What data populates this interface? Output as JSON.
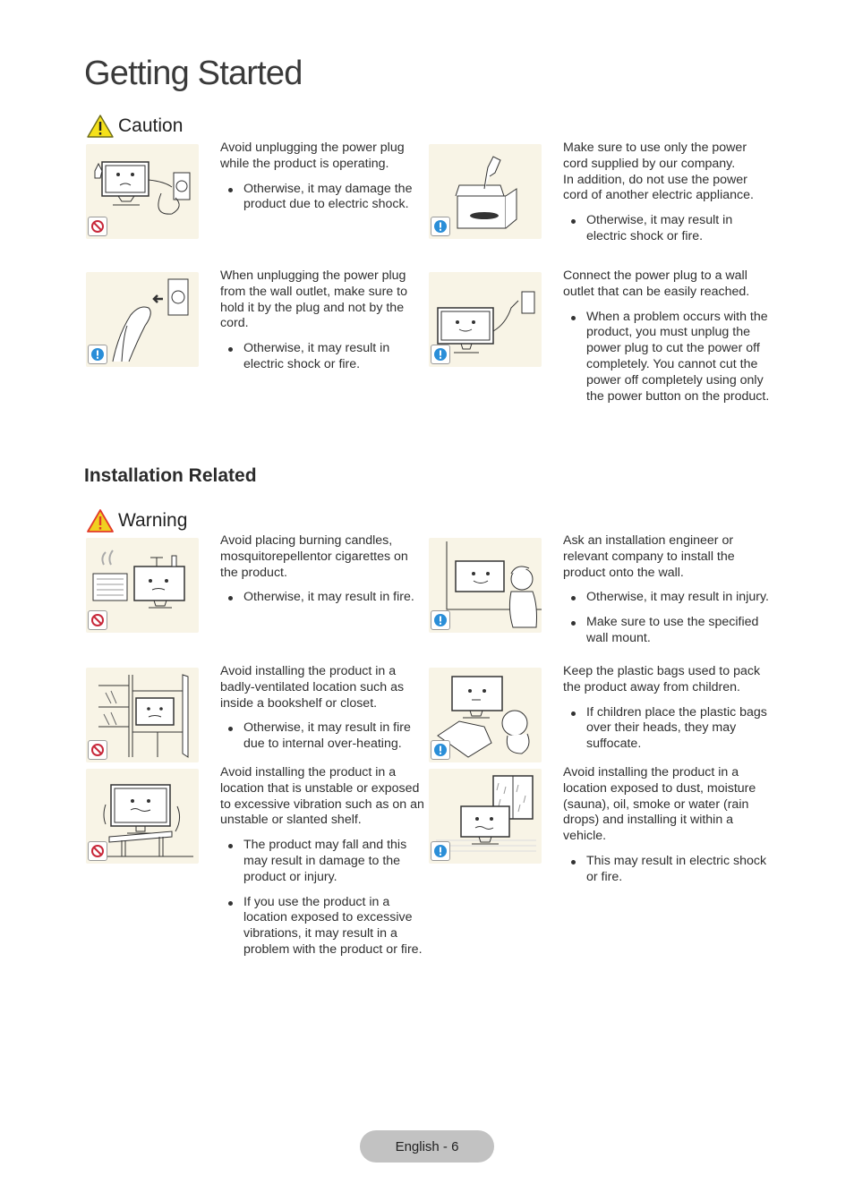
{
  "page": {
    "title": "Getting Started",
    "footer": "English - 6"
  },
  "caution": {
    "heading": "Caution",
    "heading_icon": "caution-triangle-icon",
    "icon_color": "#f5e11a",
    "items": [
      {
        "badge": "prohibited",
        "illustration": "tv-unplugging-while-operating",
        "text": "Avoid unplugging the power plug while the product is operating.",
        "bullets": [
          "Otherwise, it may damage the product due to electric shock."
        ]
      },
      {
        "badge": "caution",
        "illustration": "samsung-power-cord-box",
        "text": "Make sure to use only the power cord supplied by our company.\nIn addition, do not use the power cord of another electric appliance.",
        "bullets": [
          "Otherwise, it may result in electric shock or fire."
        ]
      },
      {
        "badge": "caution",
        "illustration": "hand-pulling-plug",
        "text": "When unplugging the power plug from the wall outlet, make sure to hold it by the plug and not by the cord.",
        "bullets": [
          "Otherwise, it may result in electric shock or fire."
        ]
      },
      {
        "badge": "caution",
        "illustration": "tv-plugging-into-outlet",
        "text": "Connect the power plug to a wall outlet that can be easily reached.",
        "bullets": [
          "When a problem occurs with the product, you must unplug the power plug to cut the power off completely. You cannot cut the power off completely using only the power button on the product."
        ]
      }
    ]
  },
  "installation": {
    "heading": "Installation Related",
    "warning": {
      "heading": "Warning",
      "heading_icon": "warning-triangle-icon",
      "icon_color": "#f0d020",
      "icon_border": "#e23a2a",
      "items": [
        {
          "badge": "prohibited",
          "illustration": "tv-with-candles-and-heater",
          "text": "Avoid placing burning candles, mosquitorepellentor cigarettes on the product.",
          "bullets": [
            "Otherwise, it may result in fire."
          ]
        },
        {
          "badge": "caution",
          "illustration": "engineer-wall-mounting-tv",
          "text": "Ask an installation engineer or relevant company to install the product onto the wall.",
          "bullets": [
            "Otherwise, it may result in injury.",
            "Make sure to use the specified wall mount."
          ]
        },
        {
          "badge": "prohibited",
          "illustration": "tv-inside-bookshelf",
          "text": "Avoid installing the product in a badly-ventilated location such as inside a bookshelf or closet.",
          "bullets": [
            "Otherwise, it may result in fire due to internal over-heating."
          ]
        },
        {
          "badge": "caution",
          "illustration": "child-with-plastic-bag",
          "text": "Keep the plastic bags used to pack the product away from children.",
          "bullets": [
            "If children place the plastic bags over their heads, they may suffocate."
          ]
        },
        {
          "badge": "prohibited",
          "illustration": "tv-on-unstable-shelf",
          "text": "Avoid installing the product in a location that is unstable or exposed to excessive vibration such as on an unstable or slanted shelf.",
          "bullets": [
            "The product may fall and this may result in damage to the product or injury.",
            "If you use the product in a location exposed to excessive vibrations, it may result in a problem with the product or fire."
          ]
        },
        {
          "badge": "caution",
          "illustration": "tv-near-rainy-window",
          "text": "Avoid installing the product in a location exposed to dust, moisture (sauna), oil, smoke or water (rain drops) and installing it within a vehicle.",
          "bullets": [
            "This may result in electric shock or fire."
          ]
        }
      ]
    }
  },
  "colors": {
    "thumb_bg": "#f8f4e6",
    "prohibit_red": "#c8283a",
    "caution_blue": "#2a8ed8",
    "footer_pill": "#c2c2c2"
  }
}
